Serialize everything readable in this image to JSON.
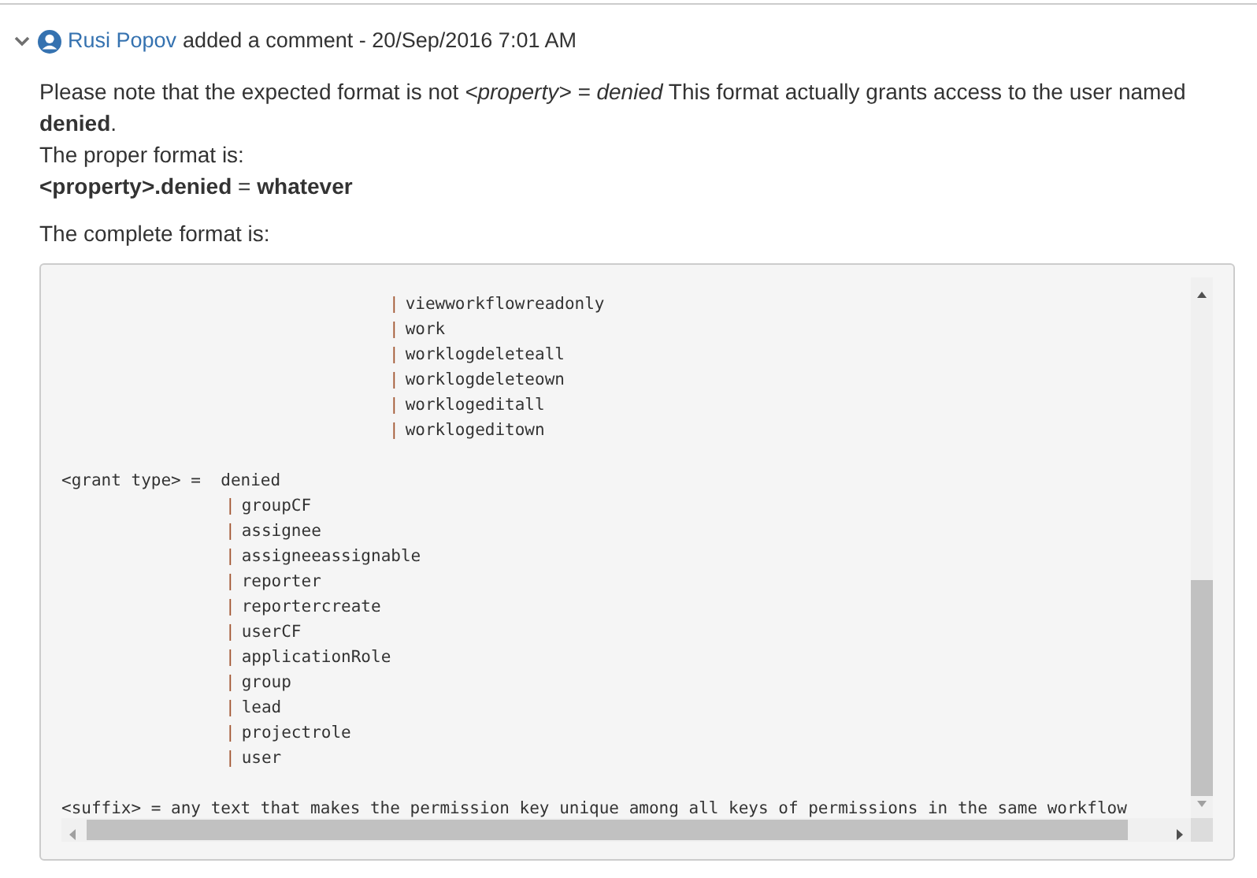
{
  "comment": {
    "expanded": true,
    "author": "Rusi Popov",
    "action": "added a comment - 20/Sep/2016 7:01 AM",
    "paragraphs": [
      "Please note that the expected format is not *<property> = denied* This format actually grants access to the user named **denied**.",
      "The proper format is:",
      "**<property>.denied** = **whatever**",
      "The complete format is:"
    ],
    "code_block": {
      "sections": [
        {
          "kind": "continuation",
          "options": [
            {
              "marker": "|",
              "text": "viewworkflowreadonly"
            },
            {
              "marker": "|",
              "text": "work"
            },
            {
              "marker": "|",
              "text": "worklogdeleteall"
            },
            {
              "marker": "|",
              "text": "worklogdeleteown"
            },
            {
              "marker": "|",
              "text": "worklogeditall"
            },
            {
              "marker": "|",
              "text": "worklogeditown"
            }
          ]
        },
        {
          "kind": "definition",
          "head": "<grant type> =  denied",
          "options": [
            {
              "marker": "|",
              "text": "groupCF"
            },
            {
              "marker": "|",
              "text": "assignee"
            },
            {
              "marker": "|",
              "text": "assigneeassignable"
            },
            {
              "marker": "|",
              "text": "reporter"
            },
            {
              "marker": "|",
              "text": "reportercreate"
            },
            {
              "marker": "|",
              "text": "userCF"
            },
            {
              "marker": "|",
              "text": "applicationRole"
            },
            {
              "marker": "|",
              "text": "group"
            },
            {
              "marker": "|",
              "text": "lead"
            },
            {
              "marker": "|",
              "text": "projectrole"
            },
            {
              "marker": "|",
              "text": "user"
            }
          ]
        },
        {
          "kind": "definition",
          "head": "<suffix> = any text that makes the permission key unique among all keys of permissions in the same workflow"
        }
      ]
    }
  }
}
